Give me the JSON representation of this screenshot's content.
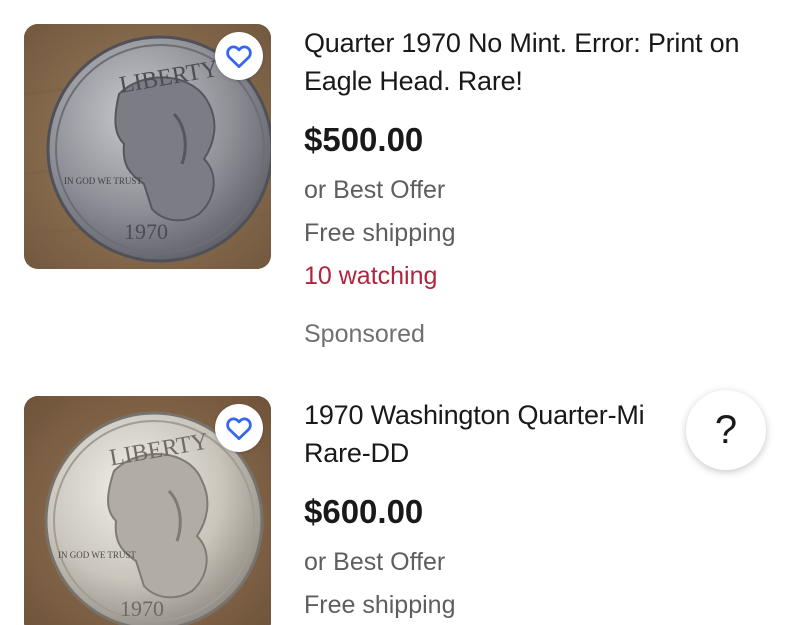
{
  "listings": [
    {
      "title": "Quarter 1970 No Mint. Error: Print on Eagle Head. Rare!",
      "price": "$500.00",
      "offer": "or Best Offer",
      "shipping": "Free shipping",
      "watching": "10 watching",
      "badge": "Sponsored",
      "coin_inscription": "LIBERTY",
      "coin_motto": "IN GOD WE TRUST",
      "coin_year": "1970"
    },
    {
      "title": "1970 Washington Quarter-Mi\nRare-DD",
      "price": "$600.00",
      "offer": "or Best Offer",
      "shipping": "Free shipping",
      "coin_inscription": "LIBERTY",
      "coin_motto": "IN GOD WE TRUST",
      "coin_year": "1970"
    }
  ],
  "help_button": {
    "label": "?"
  },
  "colors": {
    "text": "#191919",
    "secondary_text": "#5e5e5e",
    "watching": "#b1243e",
    "heart_icon": "#3665f3"
  },
  "icons": [
    "heart-outline-icon",
    "help-icon"
  ]
}
